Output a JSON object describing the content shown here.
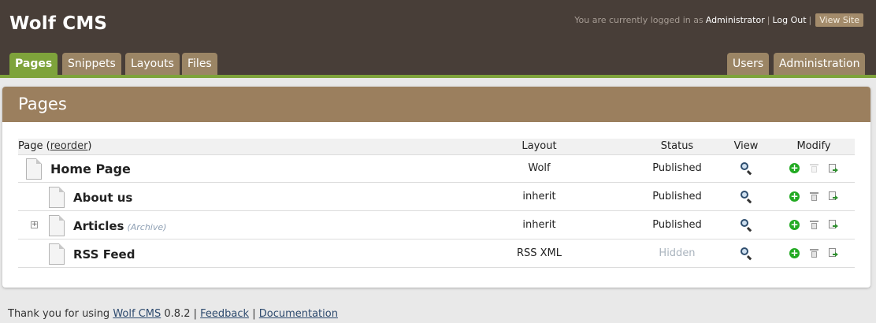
{
  "app": {
    "title": "Wolf CMS",
    "colors": {
      "header": "#483e38",
      "accent_green": "#7ea33b",
      "tab_brown": "#9b8565",
      "panel_header": "#9b7f5e"
    }
  },
  "login": {
    "prefix": "You are currently logged in as",
    "user": "Administrator",
    "separator": "|",
    "logout": "Log Out",
    "view_site": "View Site"
  },
  "tabs": {
    "left": [
      {
        "label": "Pages",
        "active": true
      },
      {
        "label": "Snippets",
        "active": false
      },
      {
        "label": "Layouts",
        "active": false
      },
      {
        "label": "Files",
        "active": false
      }
    ],
    "right": [
      {
        "label": "Users",
        "active": false
      },
      {
        "label": "Administration",
        "active": false
      }
    ]
  },
  "main": {
    "heading": "Pages",
    "columns": {
      "page_prefix": "Page (",
      "reorder": "reorder",
      "page_suffix": ")",
      "layout": "Layout",
      "status": "Status",
      "view": "View",
      "modify": "Modify"
    },
    "rows": [
      {
        "name": "Home Page",
        "note": "",
        "layout": "Wolf",
        "status": "Published",
        "level": 0,
        "expandable": false,
        "delete_enabled": false
      },
      {
        "name": "About us",
        "note": "",
        "layout": "inherit",
        "status": "Published",
        "level": 1,
        "expandable": false,
        "delete_enabled": true
      },
      {
        "name": "Articles",
        "note": "(Archive)",
        "layout": "inherit",
        "status": "Published",
        "level": 1,
        "expandable": true,
        "delete_enabled": true
      },
      {
        "name": "RSS Feed",
        "note": "",
        "layout": "RSS XML",
        "status": "Hidden",
        "level": 1,
        "expandable": false,
        "delete_enabled": true
      }
    ],
    "icons": {
      "view": "search-icon",
      "add": "add-child-icon",
      "delete": "trash-icon",
      "copy": "copy-icon",
      "page": "page-icon",
      "expand": "expand-icon"
    }
  },
  "footer": {
    "prefix": "Thank you for using",
    "cms_link": "Wolf CMS",
    "version": "0.8.2",
    "sep1": "|",
    "feedback": "Feedback",
    "sep2": "|",
    "documentation": "Documentation"
  }
}
